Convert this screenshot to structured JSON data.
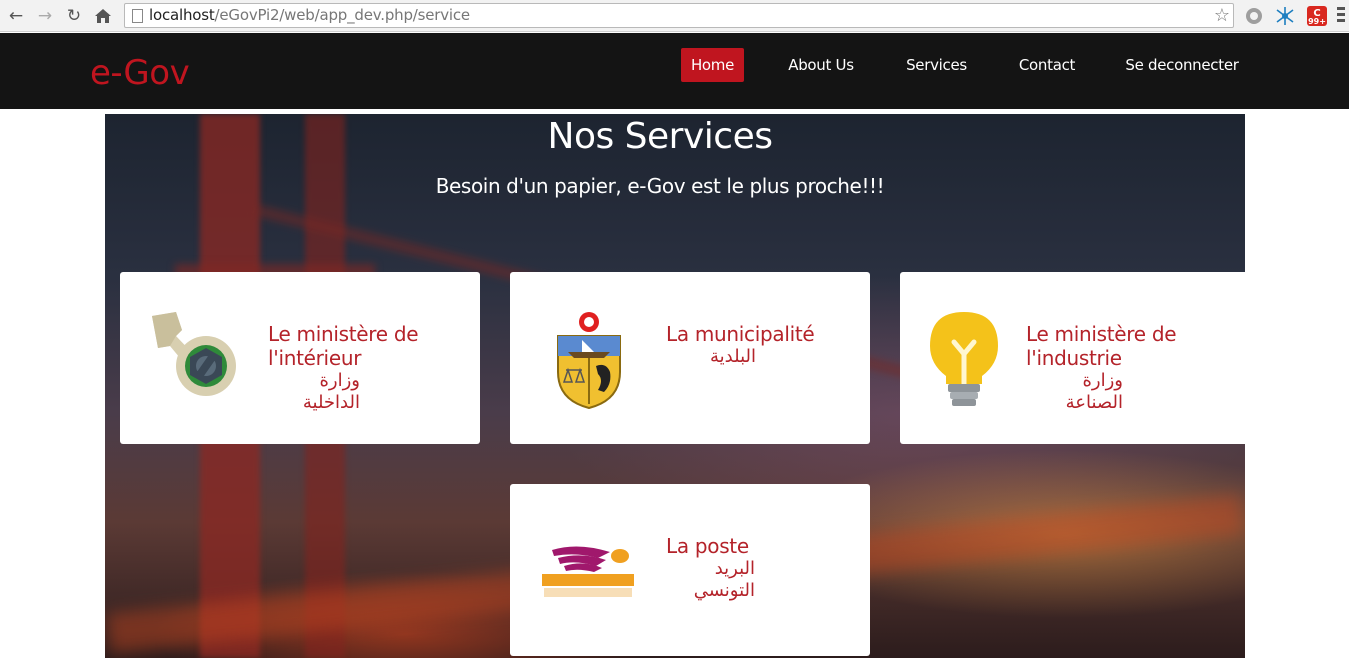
{
  "browser": {
    "url_host": "localhost",
    "url_path": "/eGovPi2/web/app_dev.php/service",
    "extension_badge": "99+"
  },
  "header": {
    "brand": "e-Gov",
    "nav": [
      "Home",
      "About Us",
      "Services",
      "Contact",
      "Se deconnecter"
    ]
  },
  "hero": {
    "title": "Nos Services",
    "subtitle": "Besoin d'un papier, e-Gov est le plus proche!!!"
  },
  "services": [
    {
      "name": "Le ministère de l'intérieur",
      "arabic": "وزارة الداخلية",
      "icon": "wrench-icon"
    },
    {
      "name": "La municipalité",
      "arabic": "البلدية",
      "icon": "tunisia-coat-of-arms-icon"
    },
    {
      "name": "Le ministère de l'industrie",
      "arabic": "وزارة الصناعة",
      "icon": "lightbulb-icon"
    },
    {
      "name": "La poste",
      "arabic": "البريد التونسي",
      "icon": "la-poste-logo"
    }
  ],
  "colors": {
    "brand": "#c0151f",
    "header_bg": "#141414",
    "card_text": "#b4232a"
  }
}
